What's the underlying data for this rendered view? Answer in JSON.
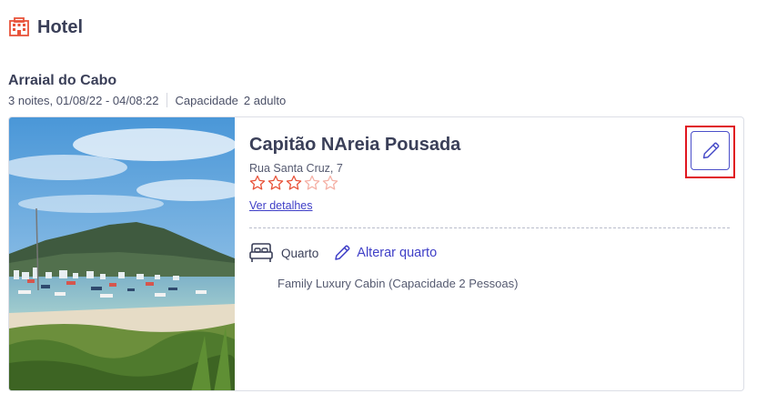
{
  "header": {
    "title": "Hotel",
    "icon": "hotel-building-icon",
    "icon_color": "#e8533a"
  },
  "trip": {
    "city": "Arraial do Cabo",
    "dates": "3 noites, 01/08/22 - 04/08:22",
    "capacity_label": "Capacidade",
    "capacity_value": "2 adulto"
  },
  "hotel": {
    "name": "Capitão NAreia Pousada",
    "address": "Rua Santa Cruz, 7",
    "rating": 3,
    "max_rating": 5,
    "details_link": "Ver detalhes",
    "photo": "harbor-beach-photo"
  },
  "room": {
    "label": "Quarto",
    "change_label": "Alterar quarto",
    "description": "Family Luxury Cabin (Capacidade 2 Pessoas)"
  },
  "colors": {
    "accent": "#3f3fc7",
    "star": "#e8533a",
    "highlight": "#e0161f",
    "text": "#3a3f58"
  }
}
